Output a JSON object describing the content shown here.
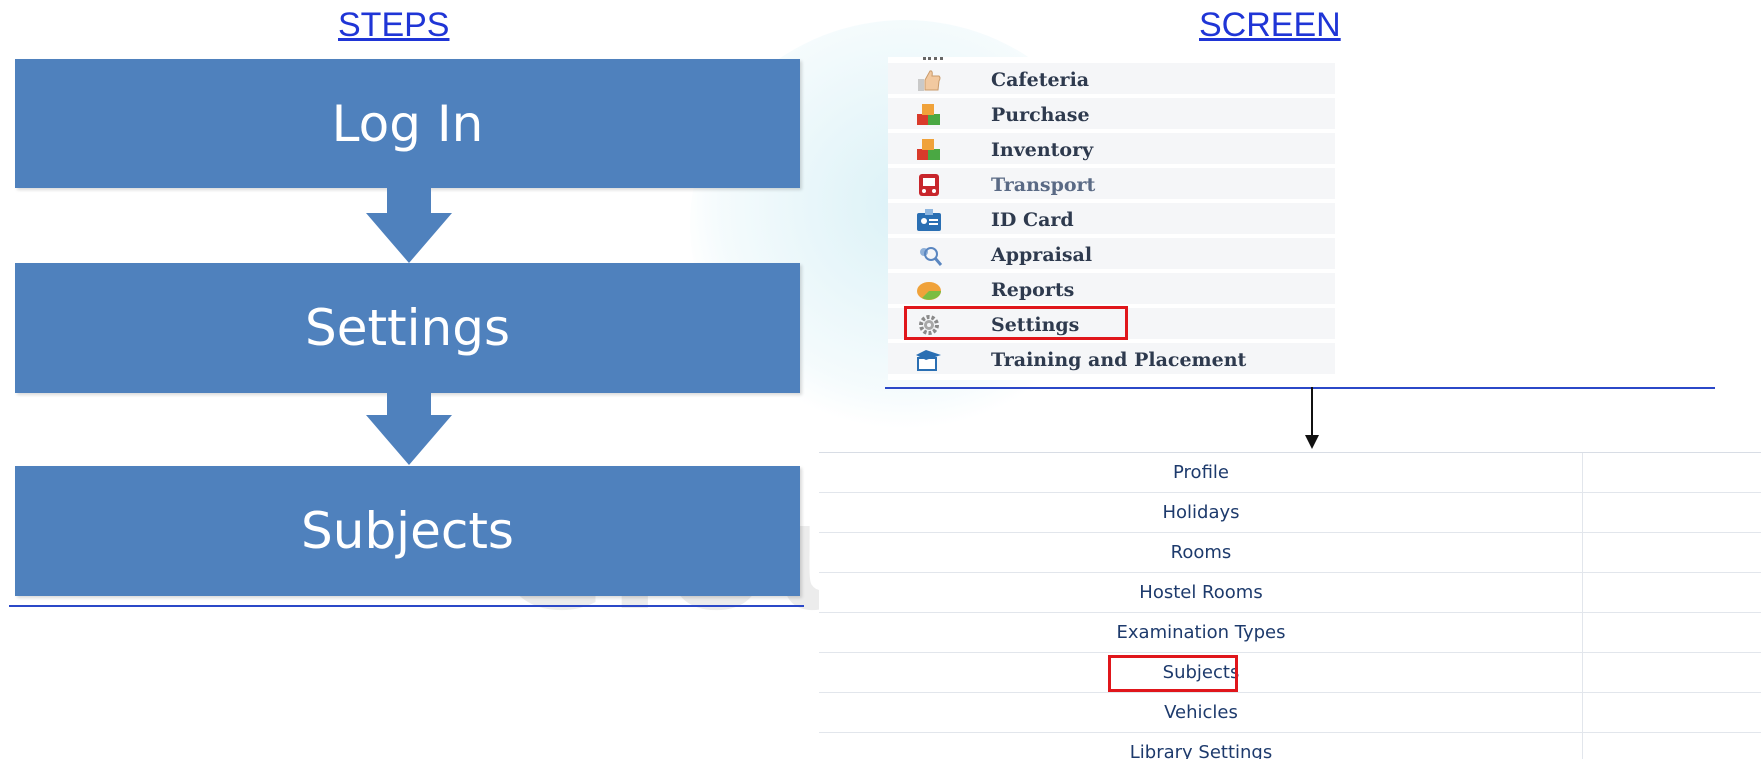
{
  "headings": {
    "steps": "STEPS",
    "screen": "SCREEN"
  },
  "steps": [
    {
      "label": "Log In"
    },
    {
      "label": "Settings"
    },
    {
      "label": "Subjects"
    }
  ],
  "menu": {
    "items": [
      {
        "label": "Cafeteria",
        "icon": "thumbs-up-icon"
      },
      {
        "label": "Purchase",
        "icon": "boxes-icon"
      },
      {
        "label": "Inventory",
        "icon": "boxes-icon"
      },
      {
        "label": "Transport",
        "icon": "bus-icon"
      },
      {
        "label": "ID Card",
        "icon": "id-card-icon"
      },
      {
        "label": "Appraisal",
        "icon": "people-search-icon"
      },
      {
        "label": "Reports",
        "icon": "pie-chart-icon"
      },
      {
        "label": "Settings",
        "icon": "gear-icon"
      },
      {
        "label": "Training and Placement",
        "icon": "graduation-icon"
      }
    ],
    "highlighted": "Settings"
  },
  "settings_list": {
    "items": [
      {
        "label": "Profile"
      },
      {
        "label": "Holidays"
      },
      {
        "label": "Rooms"
      },
      {
        "label": "Hostel Rooms"
      },
      {
        "label": "Examination Types"
      },
      {
        "label": "Subjects"
      },
      {
        "label": "Vehicles"
      },
      {
        "label": "Library Settings"
      }
    ],
    "highlighted": "Subjects"
  },
  "colors": {
    "step_fill": "#4f81bd",
    "heading_link": "#1f35d6",
    "highlight": "#e0161b"
  }
}
